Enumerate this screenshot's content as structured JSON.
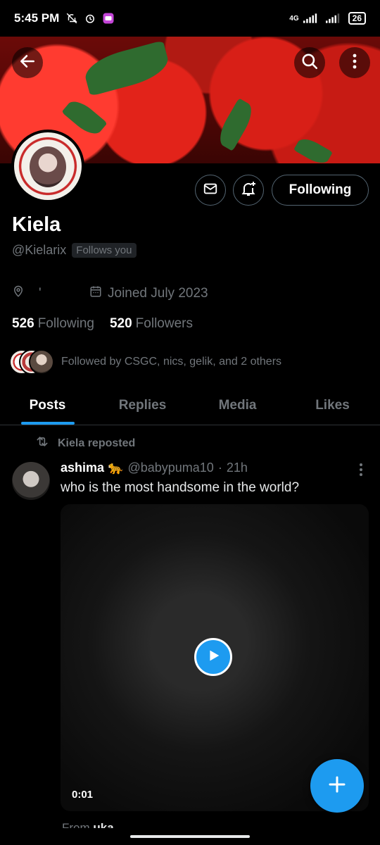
{
  "status_bar": {
    "time": "5:45 PM",
    "network": "4G",
    "battery": "26"
  },
  "profile": {
    "name": "Kiela",
    "handle": "@Kielarix",
    "follows_you": "Follows you",
    "location": "'",
    "joined": "Joined July 2023",
    "following_count": "526",
    "following_label": "Following",
    "followers_count": "520",
    "followers_label": "Followers",
    "followed_by": "Followed by CSGC, nics, gelik, and 2 others",
    "follow_button": "Following"
  },
  "tabs": [
    {
      "label": "Posts",
      "active": true
    },
    {
      "label": "Replies",
      "active": false
    },
    {
      "label": "Media",
      "active": false
    },
    {
      "label": "Likes",
      "active": false
    }
  ],
  "post": {
    "repost_label": "Kiela reposted",
    "author": "ashima 🐆",
    "handle": "@babypuma10",
    "separator": "·",
    "time": "21h",
    "text": "who is the most handsome in the world?",
    "video_duration": "0:01",
    "from_prefix": "From",
    "from_user": "uka"
  },
  "icons": {
    "back": "arrow-left-icon",
    "search": "search-icon",
    "more": "more-vertical-icon",
    "message": "mail-icon",
    "notify": "bell-plus-icon",
    "location": "location-pin-icon",
    "calendar": "calendar-icon",
    "repost": "repost-icon",
    "play": "play-icon",
    "compose": "plus-icon"
  },
  "colors": {
    "accent": "#1d9bf0",
    "background": "#000000",
    "secondary_text": "#71767b"
  }
}
